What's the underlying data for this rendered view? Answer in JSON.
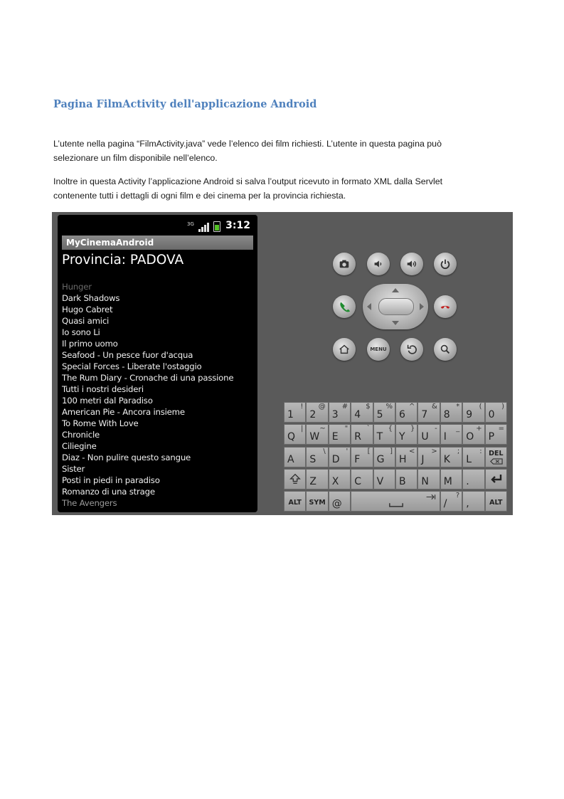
{
  "heading": "Pagina FilmActivity dell'applicazione Android",
  "paragraph_1": "L’utente nella pagina “FilmActivity.java” vede l’elenco dei film richiesti. L’utente in questa pagina può selezionare un film disponibile nell’elenco.",
  "paragraph_2": "Inoltre in questa Activity l’applicazione Android si salva l’output ricevuto in formato XML dalla Servlet contenente tutti i dettagli di ogni film e dei cinema per la provincia richiesta.",
  "emulator": {
    "status_time": "3:12",
    "network_label": "3G",
    "app_title": "MyCinemaAndroid",
    "province_title": "Provincia: PADOVA",
    "films": [
      "Hunger",
      "Dark Shadows",
      "Hugo Cabret",
      "Quasi amici",
      "Io sono Li",
      "Il primo uomo",
      "Seafood - Un pesce fuor d'acqua",
      "Special Forces - Liberate l'ostaggio",
      "The Rum Diary - Cronache di una passione",
      "Tutti i nostri desideri",
      "100 metri dal Paradiso",
      "American Pie - Ancora insieme",
      "To Rome With Love",
      "Chronicle",
      "Ciliegine",
      "Diaz - Non pulire questo sangue",
      "Sister",
      "Posti in piedi in paradiso",
      "Romanzo di una strage",
      "The Avengers"
    ],
    "menu_label": "MENU",
    "keyboard": {
      "row1": [
        [
          "1",
          "!"
        ],
        [
          "2",
          "@"
        ],
        [
          "3",
          "#"
        ],
        [
          "4",
          "$"
        ],
        [
          "5",
          "%"
        ],
        [
          "6",
          "^"
        ],
        [
          "7",
          "&"
        ],
        [
          "8",
          "*"
        ],
        [
          "9",
          "("
        ],
        [
          "0",
          ")"
        ]
      ],
      "row2": [
        [
          "Q",
          "|"
        ],
        [
          "W",
          "~"
        ],
        [
          "E",
          "\""
        ],
        [
          "R",
          "`"
        ],
        [
          "T",
          "{"
        ],
        [
          "Y",
          "}"
        ],
        [
          "U",
          "-"
        ],
        [
          "I",
          "_"
        ],
        [
          "O",
          "+"
        ],
        [
          "P",
          "="
        ]
      ],
      "row3": [
        [
          "A",
          ""
        ],
        [
          "S",
          "\\"
        ],
        [
          "D",
          "'"
        ],
        [
          "F",
          "["
        ],
        [
          "G",
          "]"
        ],
        [
          "H",
          "<"
        ],
        [
          "J",
          ">"
        ],
        [
          "K",
          ";"
        ],
        [
          "L",
          ":"
        ]
      ],
      "row4": [
        [
          "Z",
          ""
        ],
        [
          "X",
          ""
        ],
        [
          "C",
          ""
        ],
        [
          "V",
          ""
        ],
        [
          "B",
          ""
        ],
        [
          "N",
          ""
        ],
        [
          "M",
          ""
        ],
        [
          ".",
          ""
        ]
      ],
      "del_label": "DEL",
      "alt_label": "ALT",
      "sym_label": "SYM",
      "at_label": "@",
      "slash_label": "/",
      "slash_alt": "?",
      "comma_label": ","
    }
  }
}
